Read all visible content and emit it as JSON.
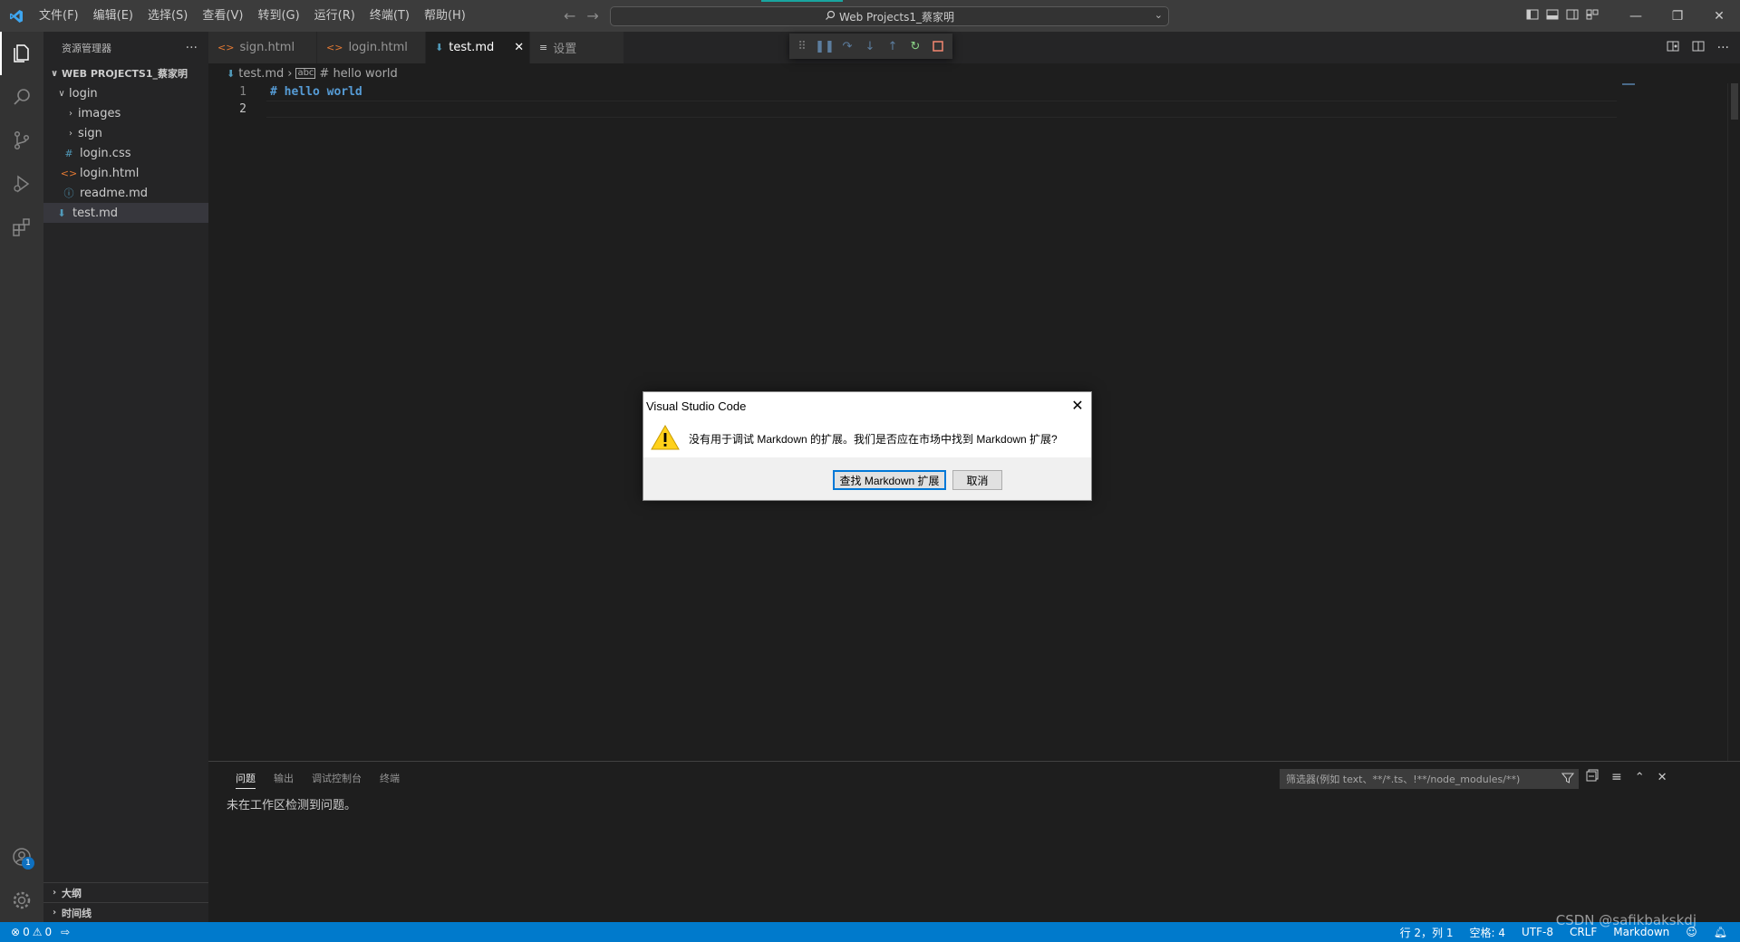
{
  "titlebar": {
    "menu": [
      "文件(F)",
      "编辑(E)",
      "选择(S)",
      "查看(V)",
      "转到(G)",
      "运行(R)",
      "终端(T)",
      "帮助(H)"
    ],
    "command_center": "Web Projects1_蔡家明"
  },
  "sidebar": {
    "header": "资源管理器",
    "folder": "WEB PROJECTS1_蔡家明",
    "tree": [
      {
        "label": "login",
        "type": "folder-open"
      },
      {
        "label": "images",
        "type": "folder"
      },
      {
        "label": "sign",
        "type": "folder"
      },
      {
        "label": "login.css",
        "type": "css"
      },
      {
        "label": "login.html",
        "type": "html"
      },
      {
        "label": "readme.md",
        "type": "info"
      },
      {
        "label": "test.md",
        "type": "md"
      }
    ],
    "outline": "大纲",
    "timeline": "时间线"
  },
  "tabs": [
    {
      "label": "sign.html"
    },
    {
      "label": "login.html"
    },
    {
      "label": "test.md"
    },
    {
      "label": "设置"
    }
  ],
  "breadcrumb": {
    "file": "test.md",
    "symbol": "# hello world"
  },
  "editor": {
    "lines": [
      {
        "number": "1",
        "text": "# hello world"
      },
      {
        "number": "2",
        "text": ""
      }
    ]
  },
  "panel": {
    "tabs": [
      "问题",
      "输出",
      "调试控制台",
      "终端"
    ],
    "message": "未在工作区检测到问题。",
    "filter_placeholder": "筛选器(例如 text、**/*.ts、!**/node_modules/**)"
  },
  "dialog": {
    "title": "Visual Studio Code",
    "message": "没有用于调试 Markdown 的扩展。我们是否应在市场中找到 Markdown 扩展?",
    "primary_button": "查找 Markdown 扩展",
    "cancel_button": "取消"
  },
  "statusbar": {
    "errors": "0",
    "warnings": "0",
    "position": "行 2，列 1",
    "spaces": "空格: 4",
    "encoding": "UTF-8",
    "eol": "CRLF",
    "language": "Markdown",
    "account_badge": "1"
  },
  "watermark": "CSDN @safikbakskdj",
  "colors": {
    "accent": "#007acc",
    "md_icon": "#519aba",
    "html_icon": "#e37933",
    "css_icon": "#519aba",
    "debug_green": "#89d185",
    "debug_red": "#f48771"
  }
}
